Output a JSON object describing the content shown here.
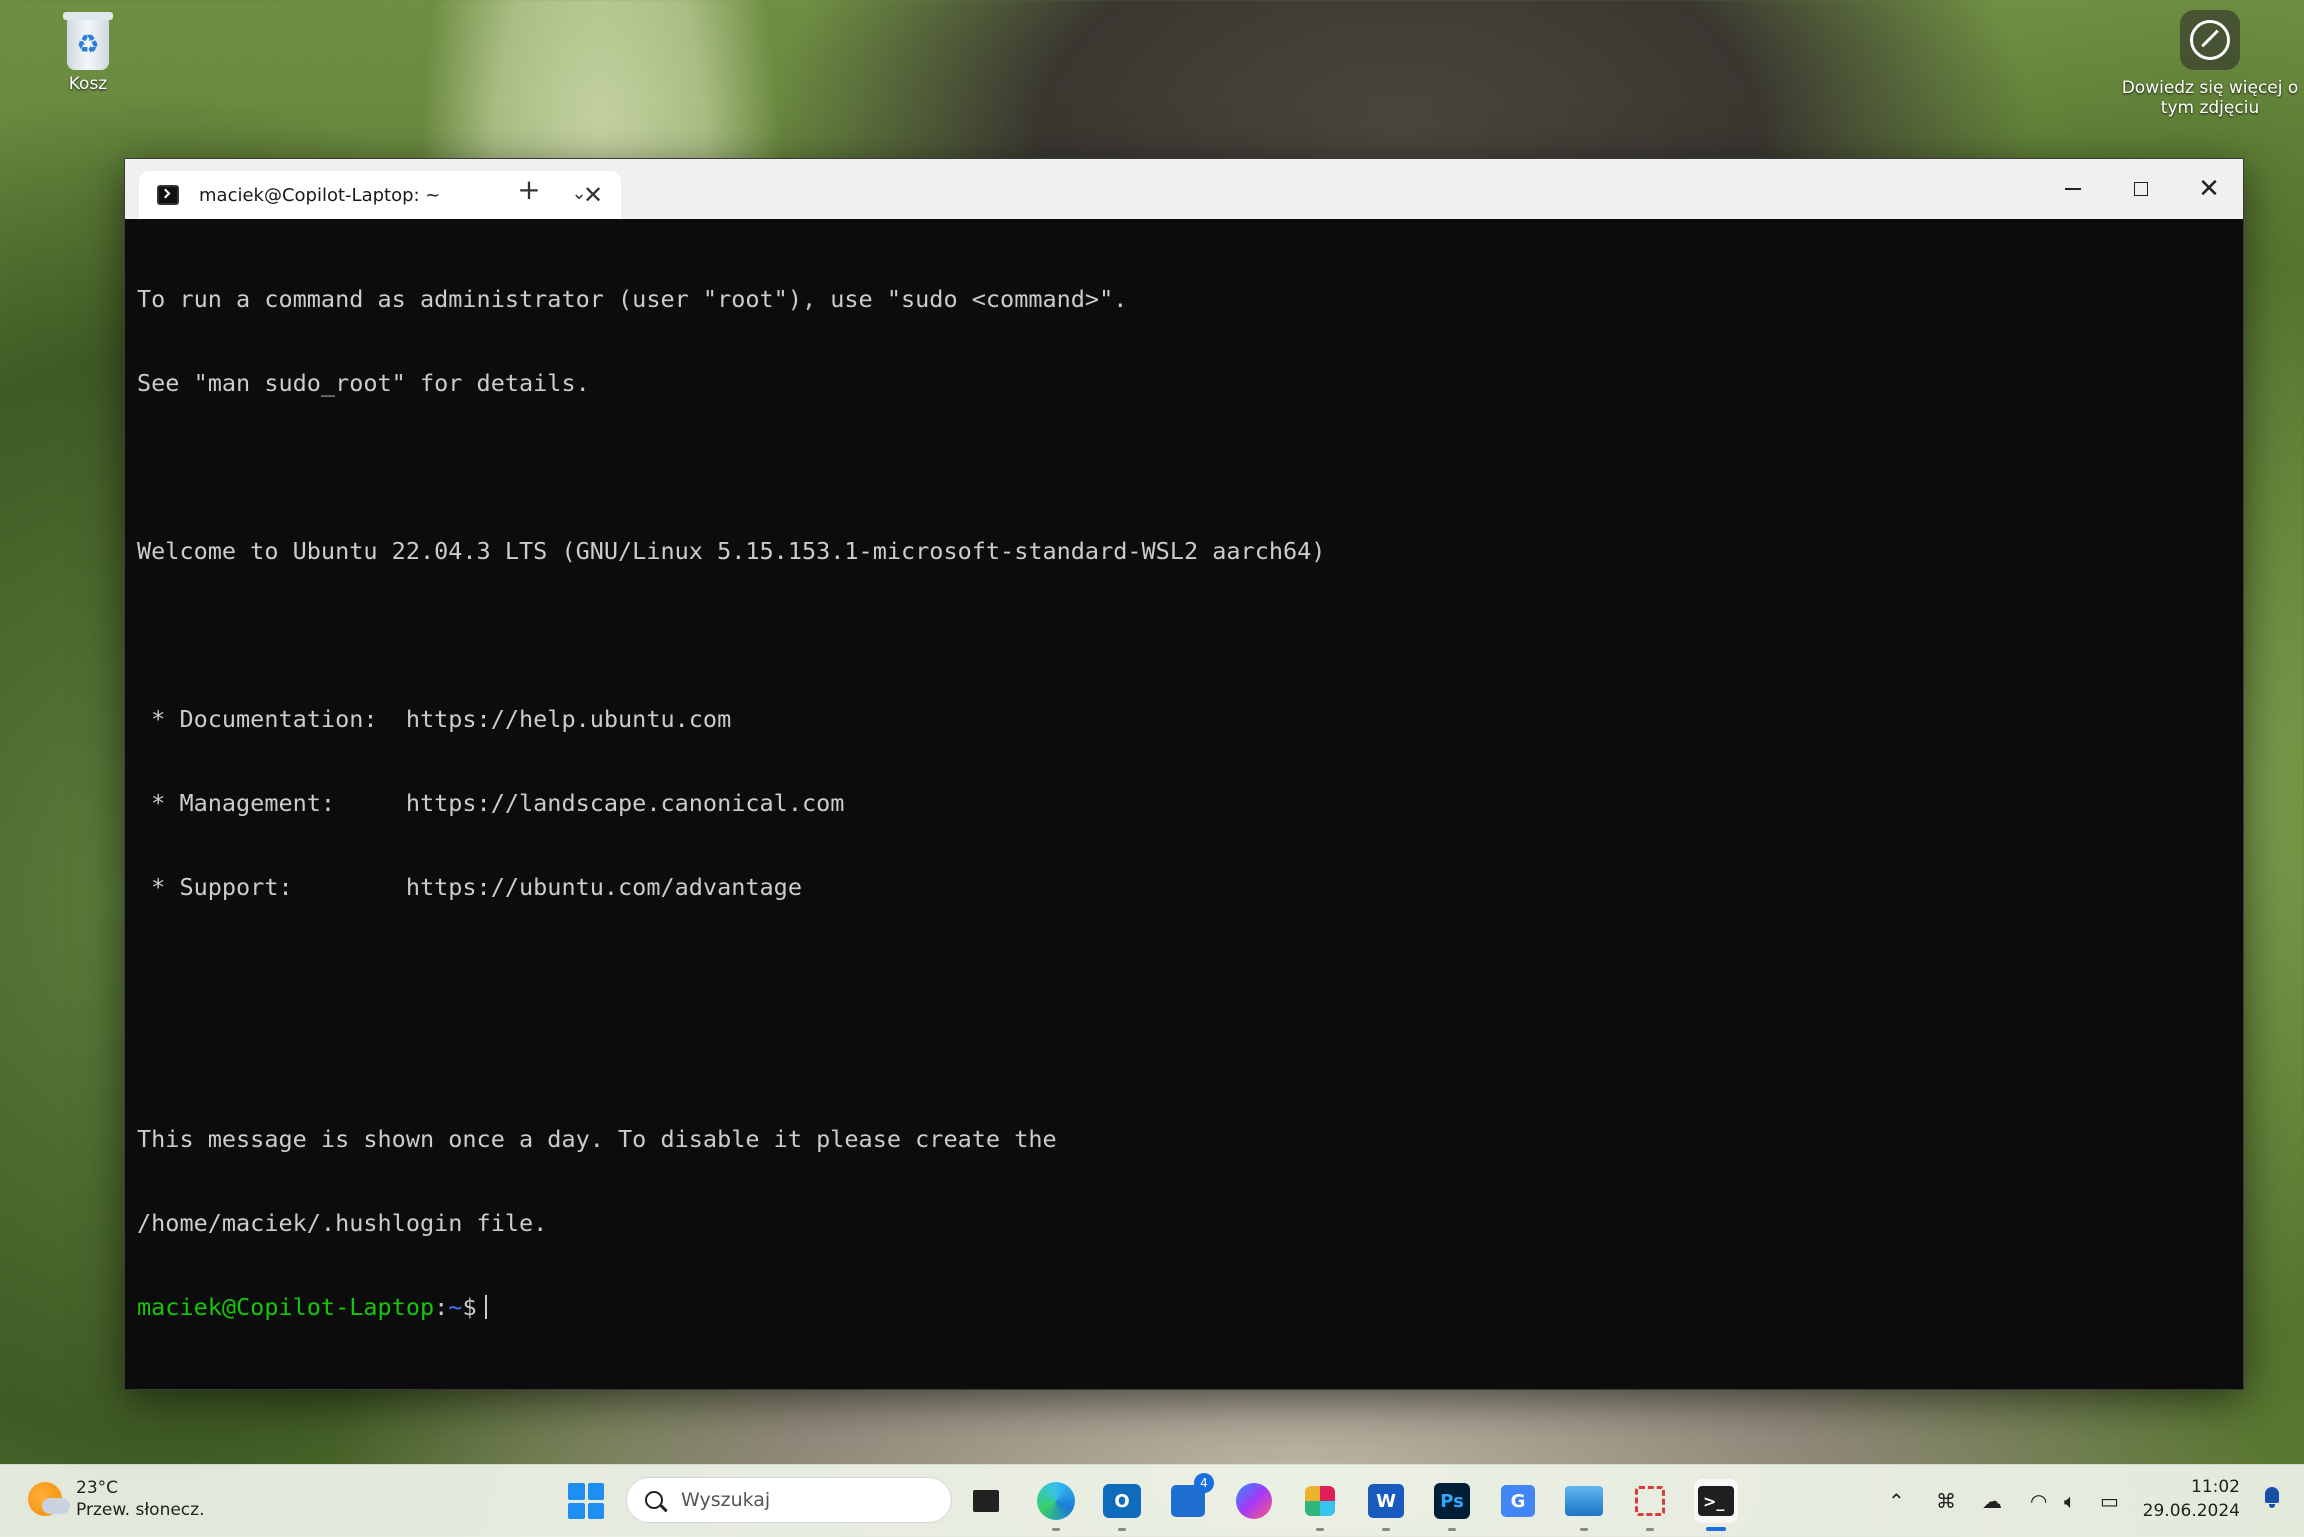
{
  "desktop": {
    "recycle_bin_label": "Kosz",
    "learn_more_label_line1": "Dowiedz się więcej o",
    "learn_more_label_line2": "tym zdjęciu"
  },
  "window": {
    "tab_title": "maciek@Copilot-Laptop: ~",
    "new_tab_symbol": "+",
    "dropdown_symbol": "⌄",
    "close_tab_symbol": "✕",
    "close_window_symbol": "✕"
  },
  "terminal": {
    "lines": [
      "To run a command as administrator (user \"root\"), use \"sudo <command>\".",
      "See \"man sudo_root\" for details.",
      "",
      "Welcome to Ubuntu 22.04.3 LTS (GNU/Linux 5.15.153.1-microsoft-standard-WSL2 aarch64)",
      "",
      " * Documentation:  https://help.ubuntu.com",
      " * Management:     https://landscape.canonical.com",
      " * Support:        https://ubuntu.com/advantage",
      "",
      "",
      "This message is shown once a day. To disable it please create the",
      "/home/maciek/.hushlogin file."
    ],
    "prompt_user": "maciek@Copilot-Laptop",
    "prompt_sep": ":",
    "prompt_path": "~",
    "prompt_symbol": "$"
  },
  "taskbar": {
    "weather_temp": "23°C",
    "weather_desc": "Przew. słonecz.",
    "search_placeholder": "Wyszukaj",
    "apps": [
      {
        "name": "file-explorer",
        "running": false
      },
      {
        "name": "edge",
        "running": true
      },
      {
        "name": "outlook-new",
        "running": true
      },
      {
        "name": "microsoft-store",
        "running": false,
        "badge": "4"
      },
      {
        "name": "messenger",
        "running": false
      },
      {
        "name": "slack",
        "running": true
      },
      {
        "name": "word",
        "running": true
      },
      {
        "name": "photoshop",
        "running": true
      },
      {
        "name": "translator",
        "running": false
      },
      {
        "name": "remote-desktop",
        "running": true
      },
      {
        "name": "snipping-tool",
        "running": true
      },
      {
        "name": "terminal",
        "running": true,
        "active": true
      }
    ],
    "store_badge": "4",
    "time": "11:02",
    "date": "29.06.2024"
  },
  "colors": {
    "terminal_bg": "#0c0c0c",
    "terminal_fg": "#cccccc",
    "prompt_user": "#16c60c",
    "prompt_path": "#3b78ff",
    "accent": "#1a6fe0"
  }
}
